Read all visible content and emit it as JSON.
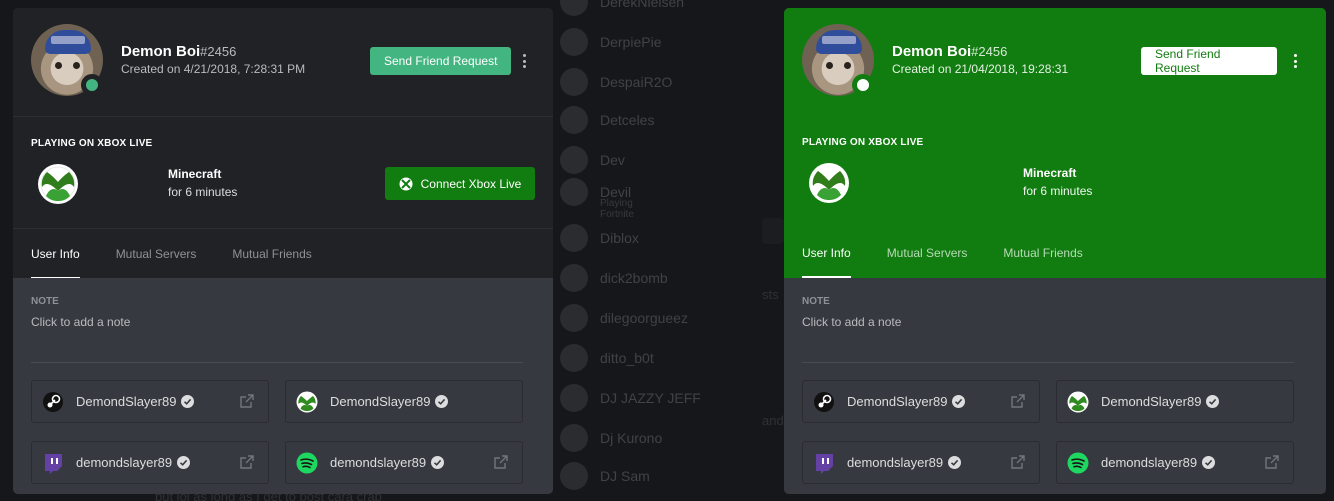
{
  "background": {
    "members": [
      {
        "name": "DerekNielsen"
      },
      {
        "name": "DerpiePie"
      },
      {
        "name": "DespaiR2O"
      },
      {
        "name": "Detceles"
      },
      {
        "name": "Dev"
      },
      {
        "name": "Devil",
        "sub": "Playing Fortnite"
      },
      {
        "name": "Diblox"
      },
      {
        "name": "dick2bomb"
      },
      {
        "name": "dilegoorgueez"
      },
      {
        "name": "ditto_b0t"
      },
      {
        "name": "DJ JAZZY JEFF"
      },
      {
        "name": "Dj Kurono"
      },
      {
        "name": "DJ Sam"
      }
    ],
    "chat_fragments": [
      "sts",
      "and",
      "but lol as long as I get to post cara crap"
    ]
  },
  "profiles": [
    {
      "variant": "default",
      "username": "Demon Boi",
      "discriminator": "#2456",
      "created": "Created on 4/21/2018, 7:28:31 PM",
      "friend_button": "Send Friend Request",
      "status": "online",
      "activity": {
        "label": "PLAYING ON XBOX LIVE",
        "game": "Minecraft",
        "duration": "for 6 minutes",
        "connect_button": "Connect Xbox Live"
      },
      "tabs": [
        {
          "label": "User Info",
          "active": true
        },
        {
          "label": "Mutual Servers",
          "active": false
        },
        {
          "label": "Mutual Friends",
          "active": false
        }
      ],
      "note": {
        "label": "NOTE",
        "placeholder": "Click to add a note"
      },
      "connections": [
        {
          "service": "steam-icon",
          "name": "DemondSlayer89",
          "verified": true,
          "external_link": true
        },
        {
          "service": "xbox-icon",
          "name": "DemondSlayer89",
          "verified": true,
          "external_link": false
        },
        {
          "service": "twitch-icon",
          "name": "demondslayer89",
          "verified": true,
          "external_link": true
        },
        {
          "service": "spotify-icon",
          "name": "demondslayer89",
          "verified": true,
          "external_link": true
        }
      ]
    },
    {
      "variant": "xbox-themed",
      "username": "Demon Boi",
      "discriminator": "#2456",
      "created": "Created on 21/04/2018, 19:28:31",
      "friend_button": "Send Friend Request",
      "status": "online",
      "activity": {
        "label": "PLAYING ON XBOX LIVE",
        "game": "Minecraft",
        "duration": "for 6 minutes"
      },
      "tabs": [
        {
          "label": "User Info",
          "active": true
        },
        {
          "label": "Mutual Servers",
          "active": false
        },
        {
          "label": "Mutual Friends",
          "active": false
        }
      ],
      "note": {
        "label": "NOTE",
        "placeholder": "Click to add a note"
      },
      "connections": [
        {
          "service": "steam-icon",
          "name": "DemondSlayer89",
          "verified": true,
          "external_link": true
        },
        {
          "service": "xbox-icon",
          "name": "DemondSlayer89",
          "verified": true,
          "external_link": false
        },
        {
          "service": "twitch-icon",
          "name": "demondslayer89",
          "verified": true,
          "external_link": true
        },
        {
          "service": "spotify-icon",
          "name": "demondslayer89",
          "verified": true,
          "external_link": true
        }
      ]
    }
  ],
  "colors": {
    "xbox_green": "#117c0f",
    "online_green": "#43b581",
    "header_dark": "#202225",
    "body_gray": "#36393f",
    "twitch_purple": "#6441a4",
    "spotify_green": "#1ed760"
  }
}
